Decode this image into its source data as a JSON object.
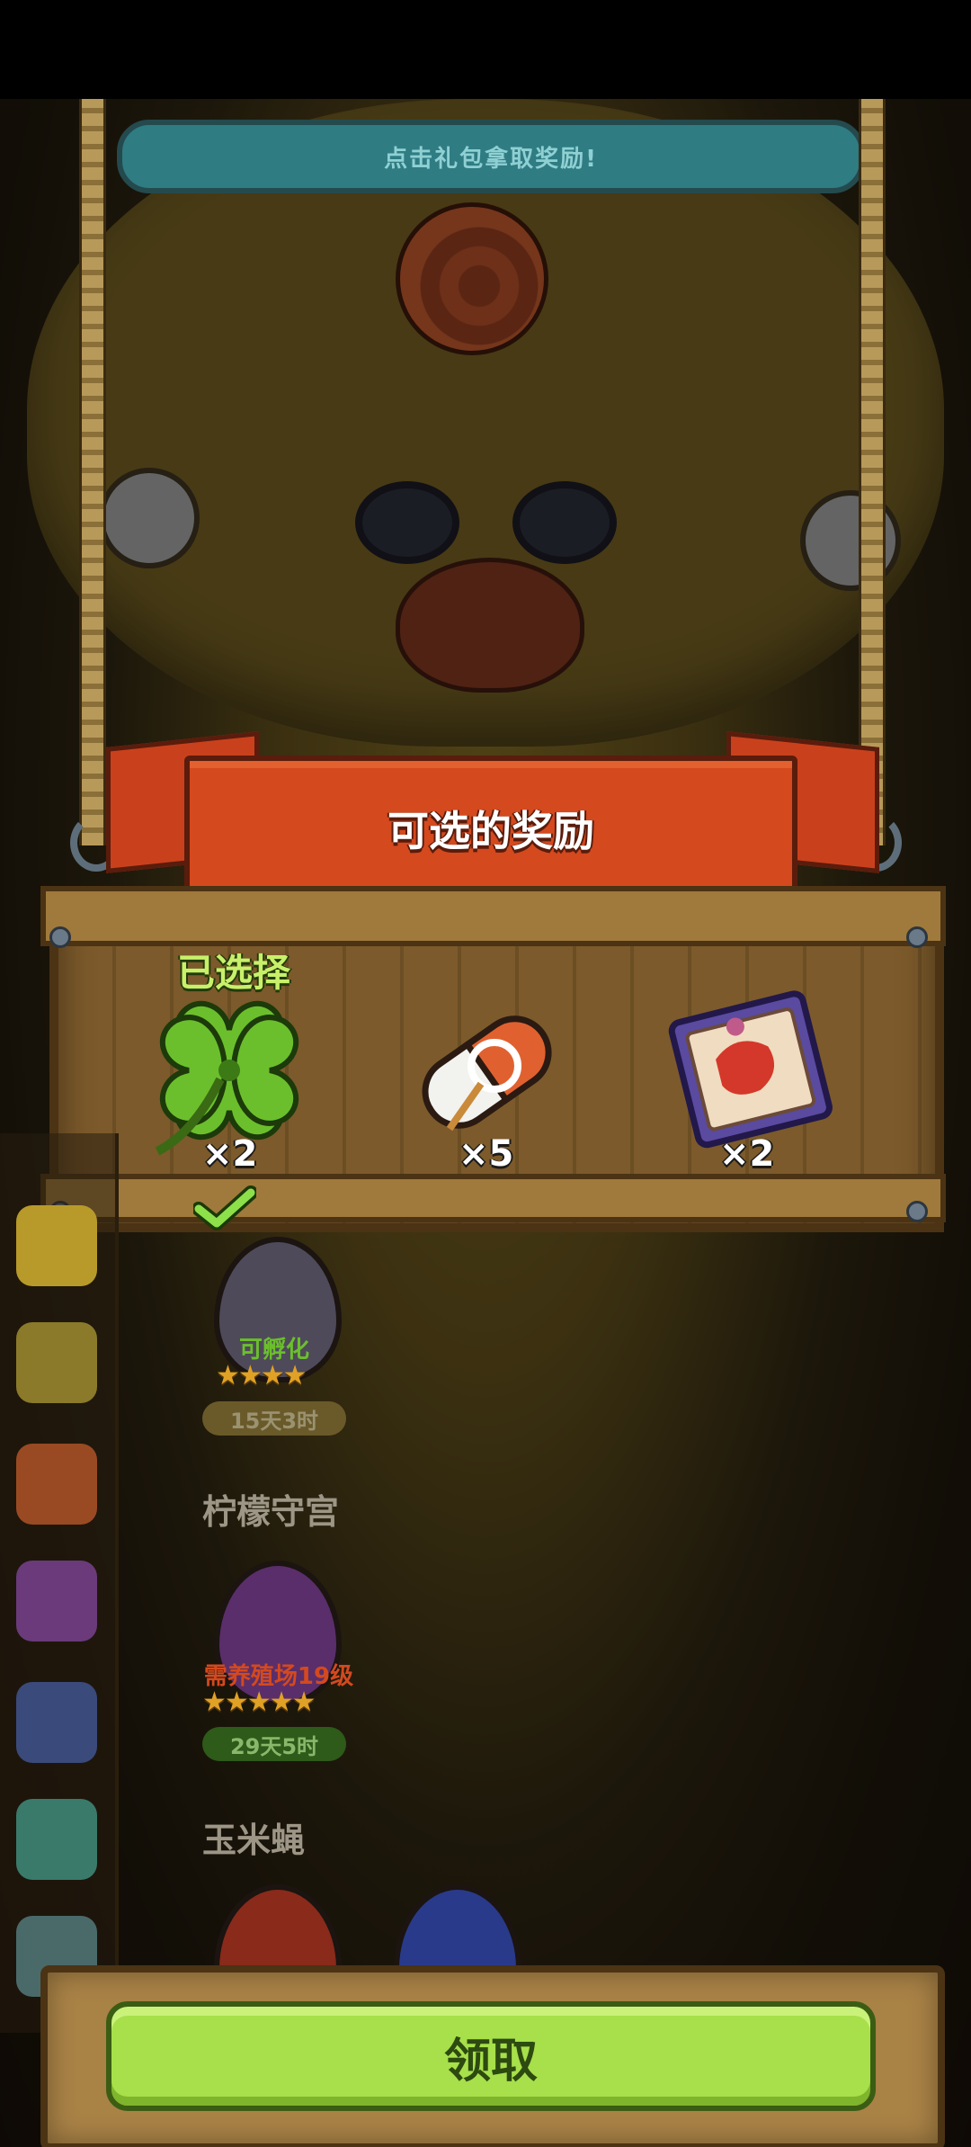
{
  "hint_bar": {
    "text": "点击礼包拿取奖励!"
  },
  "panel": {
    "title": "可选的奖励"
  },
  "rewards": [
    {
      "icon": "four-leaf-clover-icon",
      "qty": "×2",
      "selected": true,
      "selected_label": "已选择"
    },
    {
      "icon": "capsule-pill-icon",
      "qty": "×5",
      "selected": false
    },
    {
      "icon": "blueprint-scroll-icon",
      "qty": "×2",
      "selected": false
    }
  ],
  "egg_list": {
    "first_egg": {
      "status": "可孵化",
      "stars": "★★★★",
      "timer": "15天3时"
    },
    "sections": [
      {
        "name": "柠檬守宫",
        "egg": {
          "status": "需养殖场19级",
          "stars": "★★★★★",
          "timer": "29天5时"
        }
      },
      {
        "name": "玉米蝇"
      }
    ]
  },
  "claim_button": {
    "label": "领取"
  },
  "colors": {
    "banner": "#d4491e",
    "claim_button": "#a7e04a",
    "selected_text": "#c8f06a",
    "hint_bar": "#2f7c83"
  }
}
